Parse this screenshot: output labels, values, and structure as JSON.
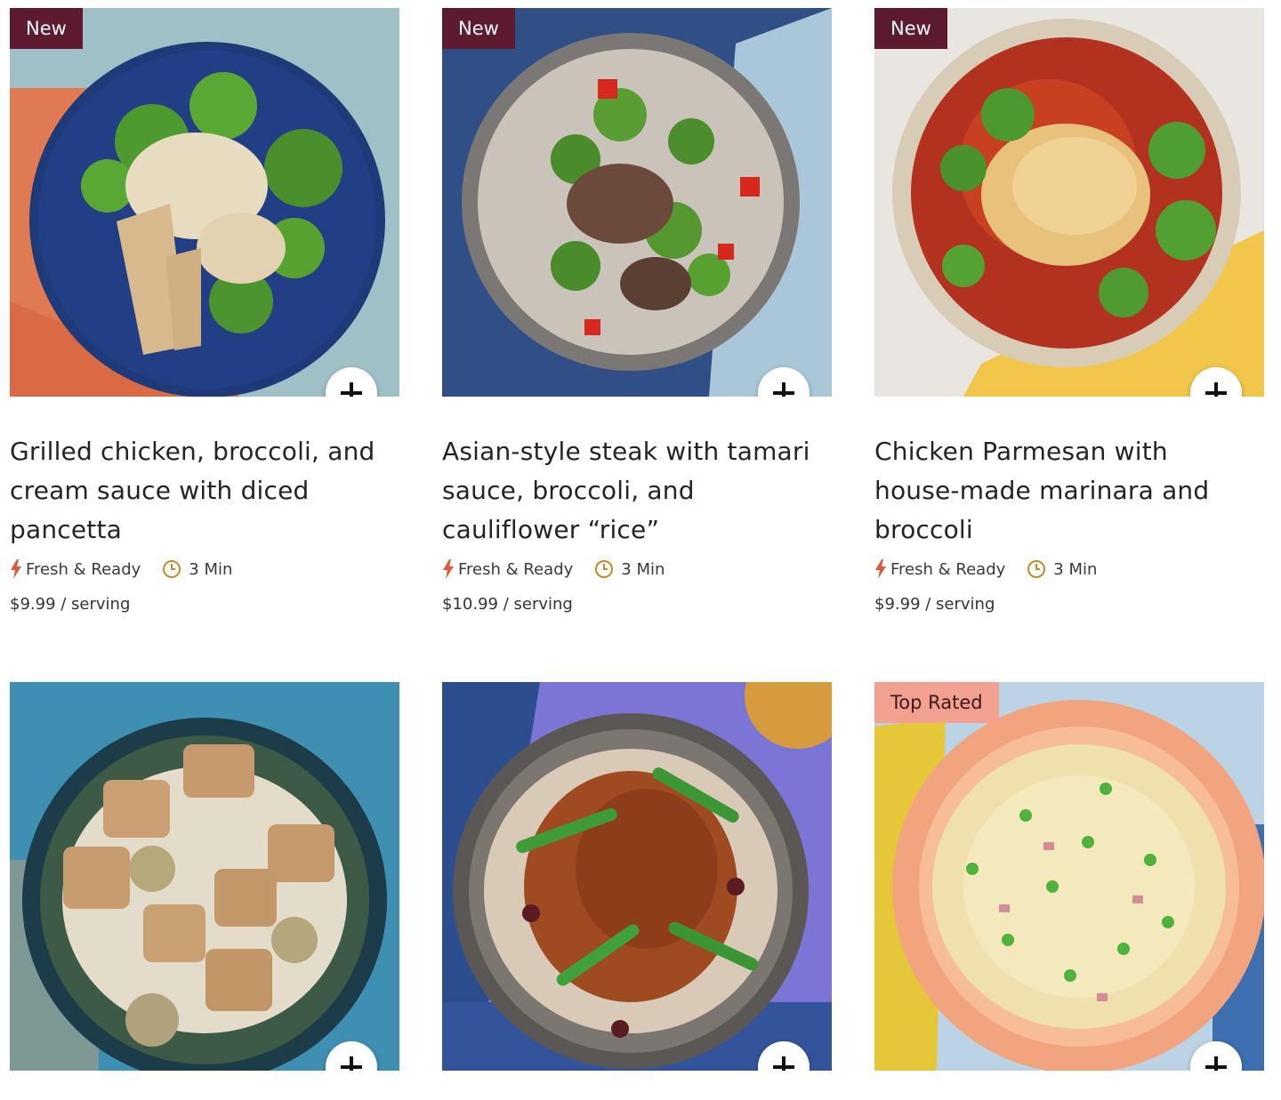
{
  "add_icon": "plus-icon",
  "badge_colors": {
    "new": "#5e1a2e",
    "top_rated": "#f2a191"
  },
  "accent_colors": {
    "bolt": "#e0583a",
    "clock": "#c08a2a"
  },
  "meals": [
    {
      "badge": "New",
      "title": "Grilled chicken, broccoli, and cream sauce with diced pancetta",
      "tag": "Fresh & Ready",
      "time": "3 Min",
      "price": "$9.99 / serving"
    },
    {
      "badge": "New",
      "title": "Asian-style steak with tamari sauce, broccoli, and cauliflower “rice”",
      "tag": "Fresh & Ready",
      "time": "3 Min",
      "price": "$10.99 / serving"
    },
    {
      "badge": "New",
      "title": "Chicken Parmesan with house-made marinara and broccoli",
      "tag": "Fresh & Ready",
      "time": "3 Min",
      "price": "$9.99 / serving"
    },
    {
      "badge": "",
      "image": "meal-photo-creamy-spinach-artichoke-chicken"
    },
    {
      "badge": "",
      "image": "meal-photo-pulled-pork-green-beans-rice"
    },
    {
      "badge": "Top Rated",
      "image": "meal-photo-spaghetti-peas-pancetta"
    }
  ]
}
